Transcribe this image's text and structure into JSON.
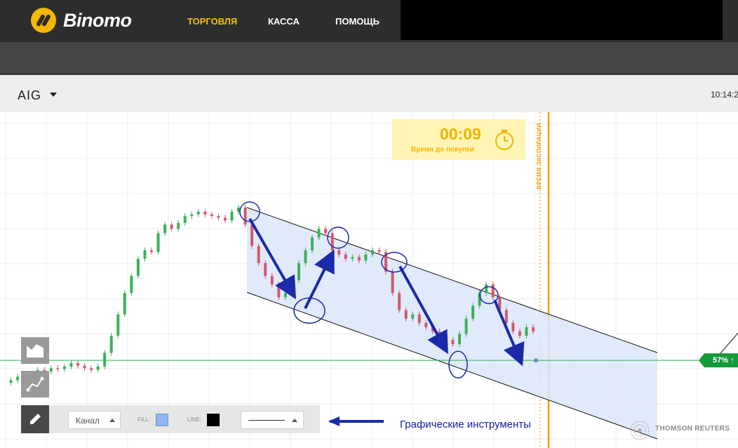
{
  "app": {
    "brand": "Binomo"
  },
  "nav": [
    {
      "label": "ТОРГОВЛЯ",
      "active": true
    },
    {
      "label": "КАССА",
      "active": false
    },
    {
      "label": "ПОМОЩЬ",
      "active": false
    }
  ],
  "asset": {
    "name": "AIG",
    "time": "10:14:2"
  },
  "timer": {
    "value": "00:09",
    "caption": "Время до покупки"
  },
  "expiration": {
    "label": "ВРЕМЯ ЭКСПИРАЦИИ"
  },
  "toolbar": {
    "tool": "Канал",
    "fill_label": "FILL:",
    "line_label": "LINE:",
    "fill_color": "#8fb4ef",
    "line_color": "#000000"
  },
  "annotation": {
    "text": "Графические инструменты"
  },
  "price_tag": {
    "text": "57% ↑"
  },
  "provider": {
    "name": "THOMSON REUTERS"
  },
  "colors": {
    "accent": "#f5c400",
    "up": "#3cb05a",
    "down": "#d0596b",
    "channel_fill": "#dce6fa",
    "arrows": "#1a2aa8",
    "price_line": "#2fb04f"
  },
  "icons": {
    "brand": "binomo-logo-icon",
    "timer": "stopwatch-icon",
    "tool": "pencil-icon",
    "chart_type": "area-chart-icon",
    "indicators": "indicator-icon",
    "provider": "globe-icon"
  },
  "chart_data": {
    "type": "candlestick",
    "series": [
      {
        "name": "",
        "note": "price movement: rise, then descending channel",
        "values": [
          0.55,
          0.58,
          0.62,
          0.6,
          0.66,
          0.7,
          0.68,
          0.72,
          0.71,
          0.74,
          0.78,
          0.75,
          0.72,
          0.7,
          0.74,
          0.9,
          1.1,
          1.35,
          1.6,
          1.8,
          2.0,
          2.1,
          2.08,
          2.3,
          2.4,
          2.35,
          2.42,
          2.5,
          2.52,
          2.55,
          2.52,
          2.5,
          2.48,
          2.45,
          2.55,
          2.6,
          2.4,
          2.15,
          1.95,
          1.8,
          1.7,
          1.55,
          1.6,
          1.75,
          1.95,
          2.1,
          2.25,
          2.35,
          2.3,
          2.1,
          2.05,
          2.0,
          2.02,
          1.98,
          2.05,
          2.1,
          2.08,
          1.85,
          1.6,
          1.4,
          1.3,
          1.35,
          1.25,
          1.2,
          1.15,
          1.1,
          1.05,
          1.0,
          1.12,
          1.3,
          1.45,
          1.6,
          1.7,
          1.55,
          1.4,
          1.25,
          1.15,
          1.1,
          1.2,
          1.15
        ]
      }
    ]
  }
}
